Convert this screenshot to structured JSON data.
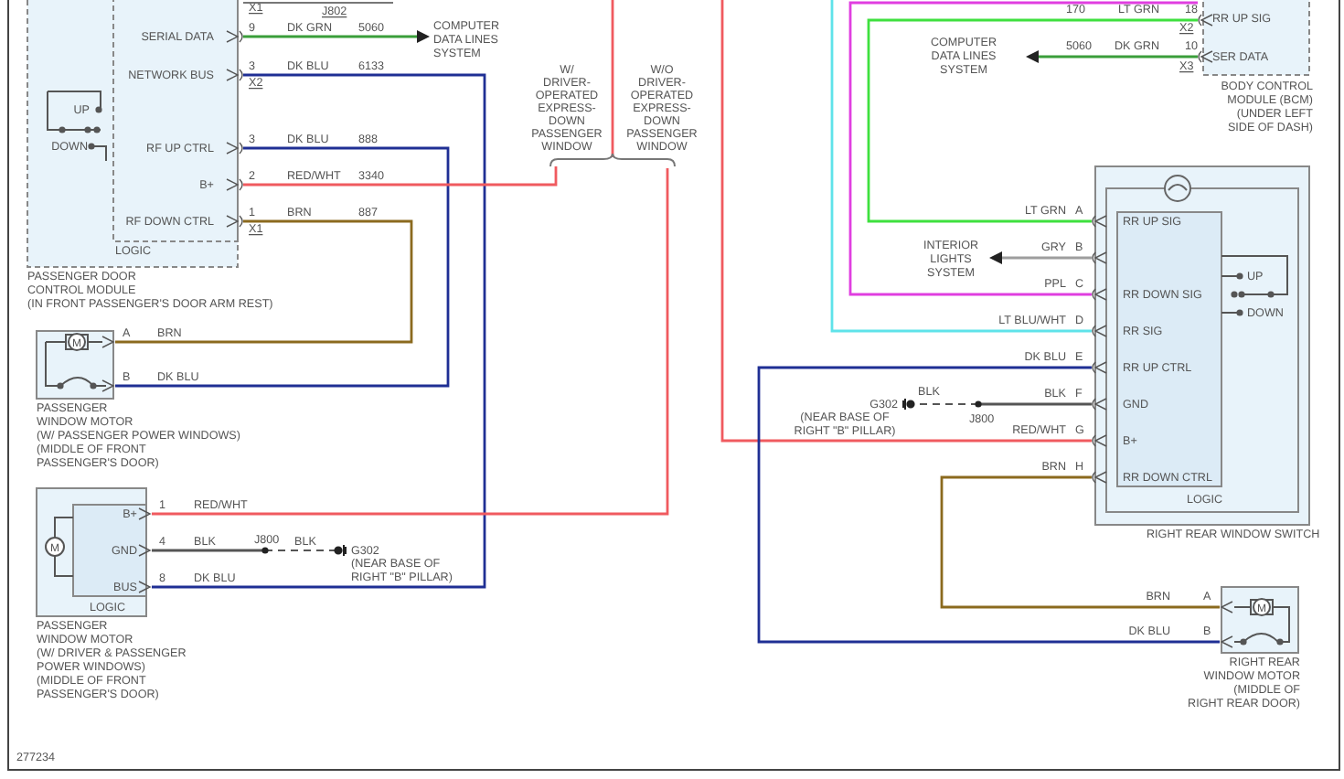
{
  "diagram_id": "277234",
  "front_module": {
    "pins": [
      "SERIAL DATA",
      "NETWORK BUS",
      "RF UP CTRL",
      "B+",
      "RF DOWN CTRL"
    ],
    "logic": "LOGIC",
    "switch": [
      "UP",
      "DOWN"
    ],
    "caption": [
      "PASSENGER DOOR",
      "CONTROL MODULE",
      "(IN FRONT PASSENGER'S DOOR ARM REST)"
    ]
  },
  "front_module_circuits": [
    {
      "pin": "9",
      "wire": "DK GRN",
      "circuit": "5060"
    },
    {
      "pin": "3",
      "wire": "DK BLU",
      "circuit": "6133"
    },
    {
      "pin": "3",
      "wire": "DK BLU",
      "circuit": "888"
    },
    {
      "pin": "2",
      "wire": "RED/WHT",
      "circuit": "3340"
    },
    {
      "pin": "1",
      "wire": "BRN",
      "circuit": "887"
    }
  ],
  "connector_labels": [
    "X1",
    "J802",
    "X2",
    "X1"
  ],
  "data_lines_left": [
    "COMPUTER",
    "DATA LINES",
    "SYSTEM"
  ],
  "options": [
    {
      "lines": [
        "W/",
        "DRIVER-",
        "OPERATED",
        "EXPRESS-",
        "DOWN",
        "PASSENGER",
        "WINDOW"
      ]
    },
    {
      "lines": [
        "W/O",
        "DRIVER-",
        "OPERATED",
        "EXPRESS-",
        "DOWN",
        "PASSENGER",
        "WINDOW"
      ]
    }
  ],
  "bcm": {
    "pins": [
      "RR UP SIG",
      "SER DATA"
    ],
    "circuits": [
      {
        "circuit": "170",
        "wire": "LT GRN",
        "pin": "18"
      },
      {
        "circuit": "5060",
        "wire": "DK GRN",
        "pin": "10"
      }
    ],
    "connectors": [
      "X2",
      "X3"
    ],
    "caption": [
      "BODY CONTROL",
      "MODULE (BCM)",
      "(UNDER LEFT",
      "SIDE OF DASH)"
    ]
  },
  "data_lines_right": [
    "COMPUTER",
    "DATA LINES",
    "SYSTEM"
  ],
  "rear_switch": {
    "pins": [
      {
        "wire": "LT GRN",
        "pin": "A",
        "label": "RR UP SIG"
      },
      {
        "wire": "GRY",
        "pin": "B"
      },
      {
        "wire": "PPL",
        "pin": "C",
        "label": "RR DOWN SIG"
      },
      {
        "wire": "LT BLU/WHT",
        "pin": "D",
        "label": "RR SIG"
      },
      {
        "wire": "DK BLU",
        "pin": "E",
        "label": "RR UP CTRL"
      },
      {
        "wire": "BLK",
        "pin": "F",
        "label": "GND"
      },
      {
        "wire": "RED/WHT",
        "pin": "G",
        "label": "B+"
      },
      {
        "wire": "BRN",
        "pin": "H",
        "label": "RR DOWN CTRL"
      }
    ],
    "logic": "LOGIC",
    "switch": [
      "UP",
      "DOWN"
    ],
    "caption": "RIGHT REAR WINDOW SWITCH"
  },
  "interior_lights": [
    "INTERIOR",
    "LIGHTS",
    "SYSTEM"
  ],
  "rear_ground": {
    "wire": "BLK",
    "splice": "J800",
    "ground": "G302",
    "location": [
      "(NEAR BASE OF",
      "RIGHT \"B\" PILLAR)"
    ]
  },
  "rear_motor": {
    "symbol": "M",
    "pins": [
      {
        "wire": "BRN",
        "pin": "A"
      },
      {
        "wire": "DK BLU",
        "pin": "B"
      }
    ],
    "caption": [
      "RIGHT REAR",
      "WINDOW MOTOR",
      "(MIDDLE OF",
      "RIGHT REAR DOOR)"
    ]
  },
  "motor_a": {
    "symbol": "M",
    "pins": [
      {
        "pin": "A",
        "wire": "BRN"
      },
      {
        "pin": "B",
        "wire": "DK BLU"
      }
    ],
    "caption": [
      "PASSENGER",
      "WINDOW MOTOR",
      "(W/ PASSENGER POWER WINDOWS)",
      "(MIDDLE OF FRONT",
      "PASSENGER'S DOOR)"
    ]
  },
  "motor_b": {
    "symbol": "M",
    "pins": [
      "B+",
      "GND",
      "BUS"
    ],
    "logic": "LOGIC",
    "circuits": [
      {
        "pin": "1",
        "wire": "RED/WHT"
      },
      {
        "pin": "4",
        "wire": "BLK"
      },
      {
        "pin": "8",
        "wire": "DK BLU"
      }
    ],
    "ground": {
      "splice": "J800",
      "wire": "BLK",
      "ground": "G302",
      "location": [
        "(NEAR BASE OF",
        "RIGHT \"B\" PILLAR)"
      ]
    },
    "caption": [
      "PASSENGER",
      "WINDOW MOTOR",
      "(W/ DRIVER & PASSENGER",
      "POWER WINDOWS)",
      "(MIDDLE OF FRONT",
      "PASSENGER'S DOOR)"
    ]
  },
  "wires": [
    {
      "color": "#3a9e3a"
    },
    {
      "color": "#1f2f94"
    },
    {
      "color": "#1f2f94"
    },
    {
      "color": "#f05a5f"
    },
    {
      "color": "#8b6a1e"
    },
    {
      "color": "#f05a5f"
    },
    {
      "color": "#5fe3ea"
    },
    {
      "color": "#e03ee0"
    },
    {
      "color": "#3ee03e"
    },
    {
      "color": "#9e9e9e"
    },
    {
      "color": "#1f2f94"
    },
    {
      "color": "#555555"
    },
    {
      "color": "#8b6a1e"
    }
  ]
}
